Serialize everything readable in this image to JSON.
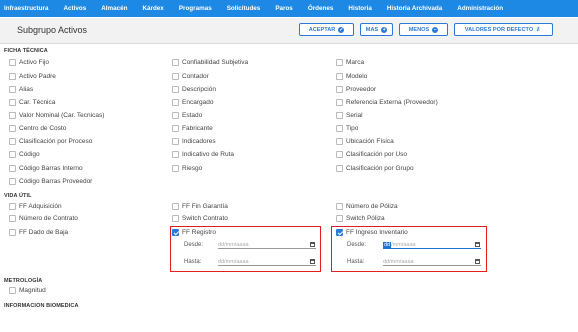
{
  "nav": [
    "Infraestructura",
    "Activos",
    "Almacén",
    "Kárdex",
    "Programas",
    "Solicitudes",
    "Paros",
    "Órdenes",
    "Historia",
    "Historia Archivada",
    "Administración"
  ],
  "header": {
    "title": "Subgrupo Activos"
  },
  "buttons": {
    "aceptar": "ACEPTAR",
    "mas": "MAS",
    "menos": "MENOS",
    "valores": "VALORES POR DEFECTO",
    "ok_icon": "check-circle-icon",
    "plus_icon": "plus-circle-icon",
    "minus_icon": "minus-circle-icon",
    "clear_icon": "clear-format-icon"
  },
  "sections": {
    "ficha": "FICHA TÉCNICA",
    "vida": "VIDA ÚTIL",
    "metro": "METROLOGÍA",
    "info": "INFORMACIÓN BIOMÉDICA"
  },
  "ficha": {
    "col1": [
      "Activo Fijo",
      "Activo Padre",
      "Alias",
      "Car. Técnica",
      "Valor Nominal (Car. Tecnicas)",
      "Centro de Costo",
      "Clasificación por Proceso",
      "Código",
      "Código Barras Interno",
      "Código Barras Proveedor"
    ],
    "col2": [
      "Confiabilidad Subjetiva",
      "Contador",
      "Descripción",
      "Encargado",
      "Estado",
      "Fabricante",
      "Indicadores",
      "Indicativo de Ruta",
      "Riesgo"
    ],
    "col3": [
      "Marca",
      "Modelo",
      "Proveedor",
      "Referencia Externa (Proveedor)",
      "Serial",
      "Tipo",
      "Ubicación Física",
      "Clasificación por Uso",
      "Clasificación por Grupo"
    ]
  },
  "vida": {
    "col1": [
      "FF Adquisición",
      "Número de Contrato",
      "FF Dado de Baja"
    ],
    "col2": [
      "FF Fin Garantía",
      "Switch Contrato",
      "FF Registro"
    ],
    "col3": [
      "Número de Póliza",
      "Switch Póliza",
      "FF Ingreso Inventario"
    ]
  },
  "date_filters": {
    "desde": "Desde:",
    "hasta": "Hasta:",
    "placeholder": "dd/mm/aaaa",
    "rest_placeholder": "/mm/aaaa",
    "active_segment": "dd",
    "calendar_icon": "calendar-icon"
  },
  "metrologia": [
    "Magnitud"
  ],
  "colors": {
    "accent": "#1e88e5",
    "highlight_border": "#e02020"
  }
}
